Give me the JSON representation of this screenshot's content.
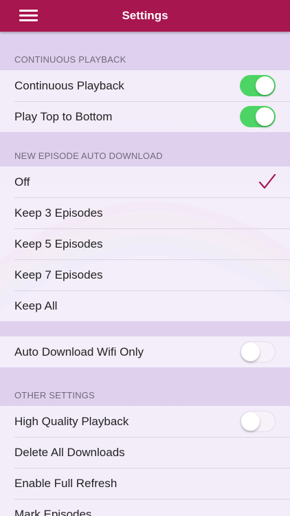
{
  "header": {
    "title": "Settings"
  },
  "sections": {
    "continuous": {
      "header": "CONTINUOUS PLAYBACK",
      "rows": [
        {
          "label": "Continuous Playback",
          "toggle": true
        },
        {
          "label": "Play Top to Bottom",
          "toggle": true
        }
      ]
    },
    "auto_download": {
      "header": "NEW EPISODE AUTO DOWNLOAD",
      "rows": [
        {
          "label": "Off",
          "selected": true
        },
        {
          "label": "Keep 3 Episodes",
          "selected": false
        },
        {
          "label": "Keep 5 Episodes",
          "selected": false
        },
        {
          "label": "Keep 7 Episodes",
          "selected": false
        },
        {
          "label": "Keep All",
          "selected": false
        }
      ]
    },
    "wifi": {
      "rows": [
        {
          "label": "Auto Download Wifi Only",
          "toggle": false
        }
      ]
    },
    "other": {
      "header": "OTHER SETTINGS",
      "rows": [
        {
          "label": "High Quality Playback",
          "toggle": false
        },
        {
          "label": "Delete All Downloads"
        },
        {
          "label": "Enable Full Refresh"
        },
        {
          "label": "Mark Episodes"
        }
      ]
    }
  },
  "colors": {
    "header_bg": "#a8164f",
    "toggle_on": "#4cd564",
    "checkmark": "#a8164f"
  },
  "icons": {
    "menu": "hamburger-menu-icon",
    "check": "checkmark-icon"
  }
}
